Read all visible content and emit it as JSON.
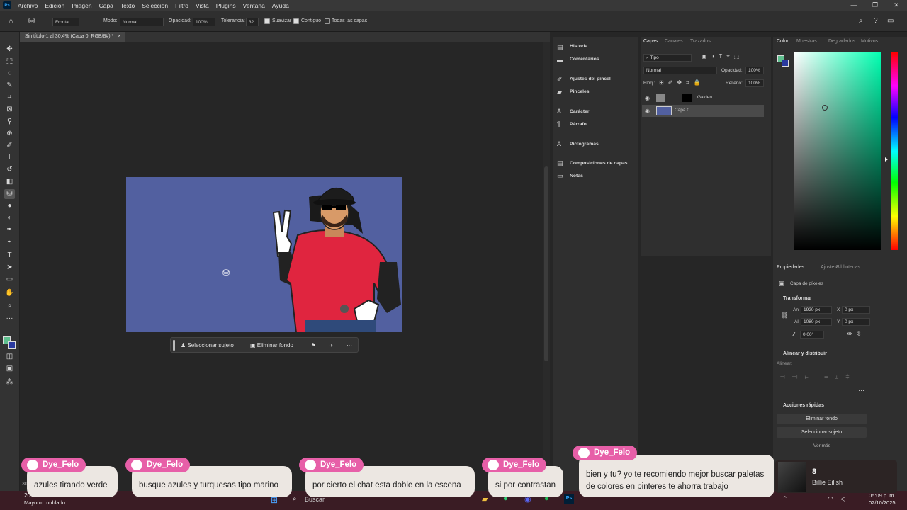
{
  "menubar": {
    "logo": "Ps",
    "items": [
      "Archivo",
      "Edición",
      "Imagen",
      "Capa",
      "Texto",
      "Selección",
      "Filtro",
      "Vista",
      "Plugins",
      "Ventana",
      "Ayuda"
    ]
  },
  "options": {
    "brush_mode": "Frontal",
    "mode_label": "Modo:",
    "mode_value": "Normal",
    "opacity_label": "Opacidad:",
    "opacity_value": "100%",
    "tolerance_label": "Tolerancia:",
    "tolerance_value": "32",
    "smooth_label": "Suavizar",
    "contiguous_label": "Contiguo",
    "all_layers_label": "Todas las capas"
  },
  "document": {
    "tab_title": "Sin título-1 al 30.4% (Capa 0, RGB/8#) *",
    "close": "×",
    "zoom_fragment": "30"
  },
  "context_bar": {
    "select_subject": "Seleccionar sujeto",
    "remove_bg": "Eliminar fondo",
    "more": "···"
  },
  "mid_panel": {
    "items": [
      "Historia",
      "Comentarios",
      "Ajustes del pincel",
      "Pinceles",
      "Carácter",
      "Párrafo",
      "Pictogramas",
      "Composiciones de capas",
      "Notas"
    ]
  },
  "layers_panel": {
    "tabs": [
      "Capas",
      "Canales",
      "Trazados"
    ],
    "filter_label": "Tipo",
    "blend_mode": "Normal",
    "opacity_label": "Opacidad:",
    "opacity_value": "100%",
    "lock_label": "Bloq.:",
    "fill_label": "Relleno:",
    "fill_value": "100%",
    "layers": [
      {
        "name": "Gaiden",
        "visible": true
      },
      {
        "name": "Capa 0",
        "visible": true,
        "selected": true
      }
    ]
  },
  "color_panel": {
    "tabs": [
      "Color",
      "Muestras",
      "Degradados",
      "Motivos"
    ],
    "foreground": "#5fbf8e",
    "background": "#2a3aa0"
  },
  "properties_panel": {
    "tabs": [
      "Propiedades",
      "Ajustes",
      "Bibliotecas"
    ],
    "layer_type": "Capa de píxeles",
    "transform_title": "Transformar",
    "w_label": "An",
    "w_value": "1920 px",
    "h_label": "Al",
    "h_value": "1080 px",
    "x_label": "X",
    "x_value": "0 px",
    "y_label": "Y",
    "y_value": "0 px",
    "angle_value": "0.00°",
    "align_title": "Alinear y distribuir",
    "align_label": "Alinear:",
    "quick_title": "Acciones rápidas",
    "quick_remove_bg": "Eliminar fondo",
    "quick_select_subject": "Seleccionar sujeto",
    "more_link": "Ver más"
  },
  "chat": {
    "username": "Dye_Felo",
    "messages": [
      "azules tirando verde",
      "busque azules y turquesas tipo marino",
      "por cierto el chat esta doble en la escena",
      "si por contrastan",
      "bien y tu? yo te recomiendo mejor buscar paletas",
      "de colores en pinteres te ahorra trabajo"
    ]
  },
  "music": {
    "track": "8",
    "artist": "Billie Eilish"
  },
  "taskbar": {
    "weather_temp": "20",
    "weather_text": "Mayorm. nublado",
    "search_placeholder": "Buscar",
    "time": "05:09 p. m.",
    "date": "02/10/2025"
  },
  "accent_colors": {
    "canvas_bg": "#5260a0",
    "chat_badge": "#e75fa8",
    "shirt": "#e0253f"
  }
}
